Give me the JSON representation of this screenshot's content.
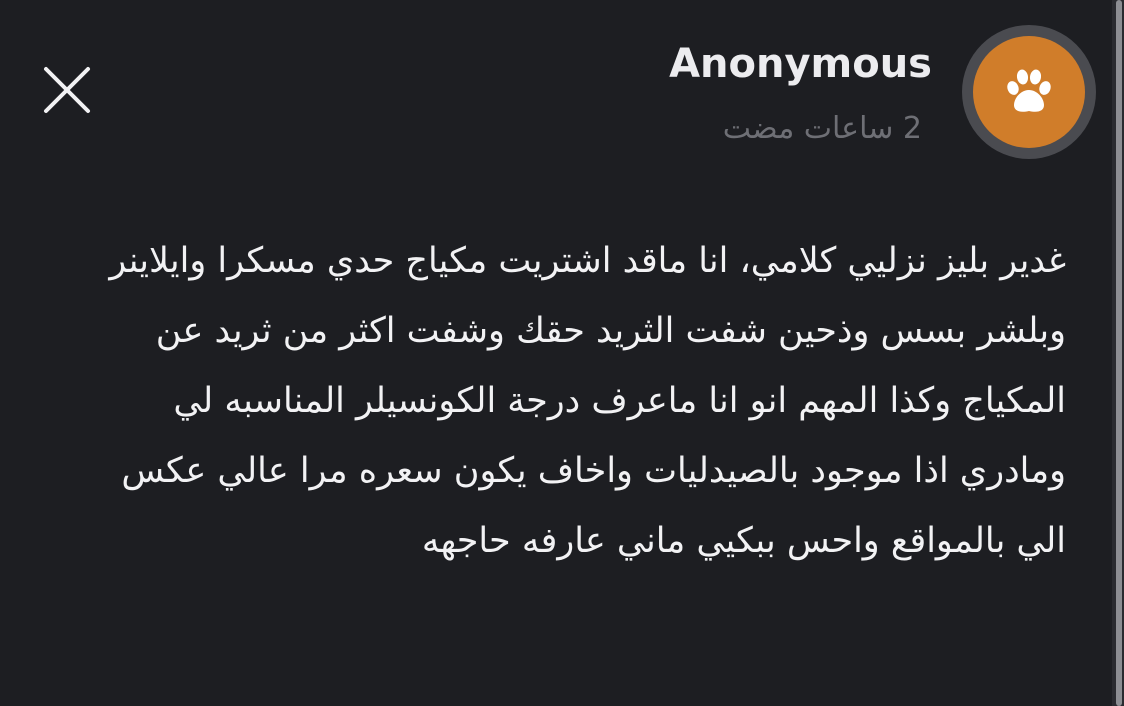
{
  "post": {
    "author": "Anonymous",
    "time_ago": "2 ساعات مضت",
    "body": "غدير بليز نزليي كلامي، انا ماقد اشتريت مكياج حدي مسكرا وايلاينر وبلشر بسس وذحين شفت الثريد حقك وشفت اكثر من ثريد عن المكياج وكذا المهم انو انا ماعرف درجة الكونسيلر المناسبه لي ومادري اذا موجود بالصيدليات واخاف يكون سعره مرا عالي عكس الي بالمواقع واحس ببكيي ماني عارفه حاجهه"
  },
  "icons": {
    "close": "close-icon",
    "avatar": "paw-icon"
  },
  "colors": {
    "background": "#1d1e22",
    "avatar_fill": "#d07d2a",
    "avatar_ring": "#4a4b50",
    "text_primary": "#f2f2f4",
    "text_secondary": "#6e6f75"
  }
}
